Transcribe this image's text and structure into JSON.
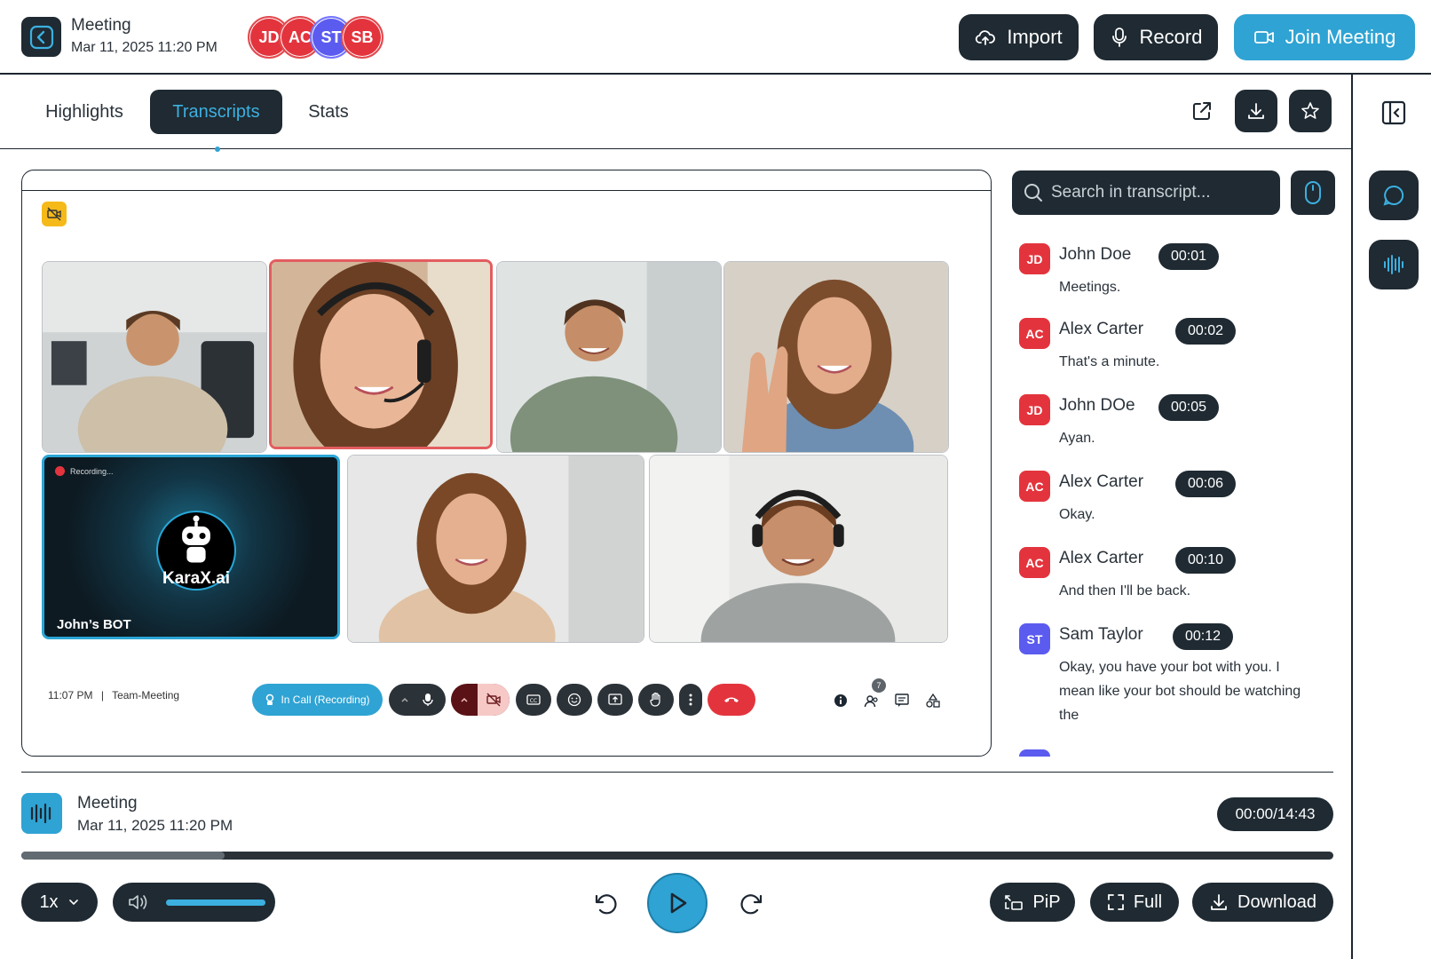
{
  "header": {
    "title": "Meeting",
    "date": "Mar 11, 2025 11:20 PM",
    "participants": [
      {
        "initials": "JD",
        "color": "#e3343d"
      },
      {
        "initials": "AC",
        "color": "#e3343d"
      },
      {
        "initials": "ST",
        "color": "#5b5bf0"
      },
      {
        "initials": "SB",
        "color": "#e3343d"
      }
    ],
    "import_label": "Import",
    "record_label": "Record",
    "join_label": "Join Meeting"
  },
  "tabs": {
    "highlights": "Highlights",
    "transcripts": "Transcripts",
    "stats": "Stats",
    "active": "Transcripts"
  },
  "video": {
    "bot_recording_label": "Recording...",
    "bot_logo_text": "KaraX.ai",
    "bot_name": "John’s BOT",
    "call_time": "11:07 PM",
    "call_name": "Team-Meeting",
    "in_call_label": "In Call (Recording)",
    "people_count": "7"
  },
  "transcript": {
    "search_placeholder": "Search in transcript...",
    "entries": [
      {
        "initials": "JD",
        "color": "#e3343d",
        "name": "John Doe",
        "time": "00:01",
        "text": "Meetings."
      },
      {
        "initials": "AC",
        "color": "#e3343d",
        "name": "Alex Carter",
        "time": "00:02",
        "text": "That's a minute."
      },
      {
        "initials": "JD",
        "color": "#e3343d",
        "name": "John DOe",
        "time": "00:05",
        "text": "Ayan."
      },
      {
        "initials": "AC",
        "color": "#e3343d",
        "name": "Alex Carter",
        "time": "00:06",
        "text": "Okay."
      },
      {
        "initials": "AC",
        "color": "#e3343d",
        "name": "Alex Carter",
        "time": "00:10",
        "text": "And then I'll be back."
      },
      {
        "initials": "ST",
        "color": "#5b5bf0",
        "name": "Sam Taylor",
        "time": "00:12",
        "text": "Okay, you have your bot with you. I mean like your bot should be watching the"
      }
    ]
  },
  "player": {
    "title": "Meeting",
    "date": "Mar 11, 2025 11:20 PM",
    "time": "00:00/14:43",
    "progress": 0.155,
    "volume": 1.0,
    "speed": "1x",
    "pip_label": "PiP",
    "full_label": "Full",
    "download_label": "Download"
  }
}
